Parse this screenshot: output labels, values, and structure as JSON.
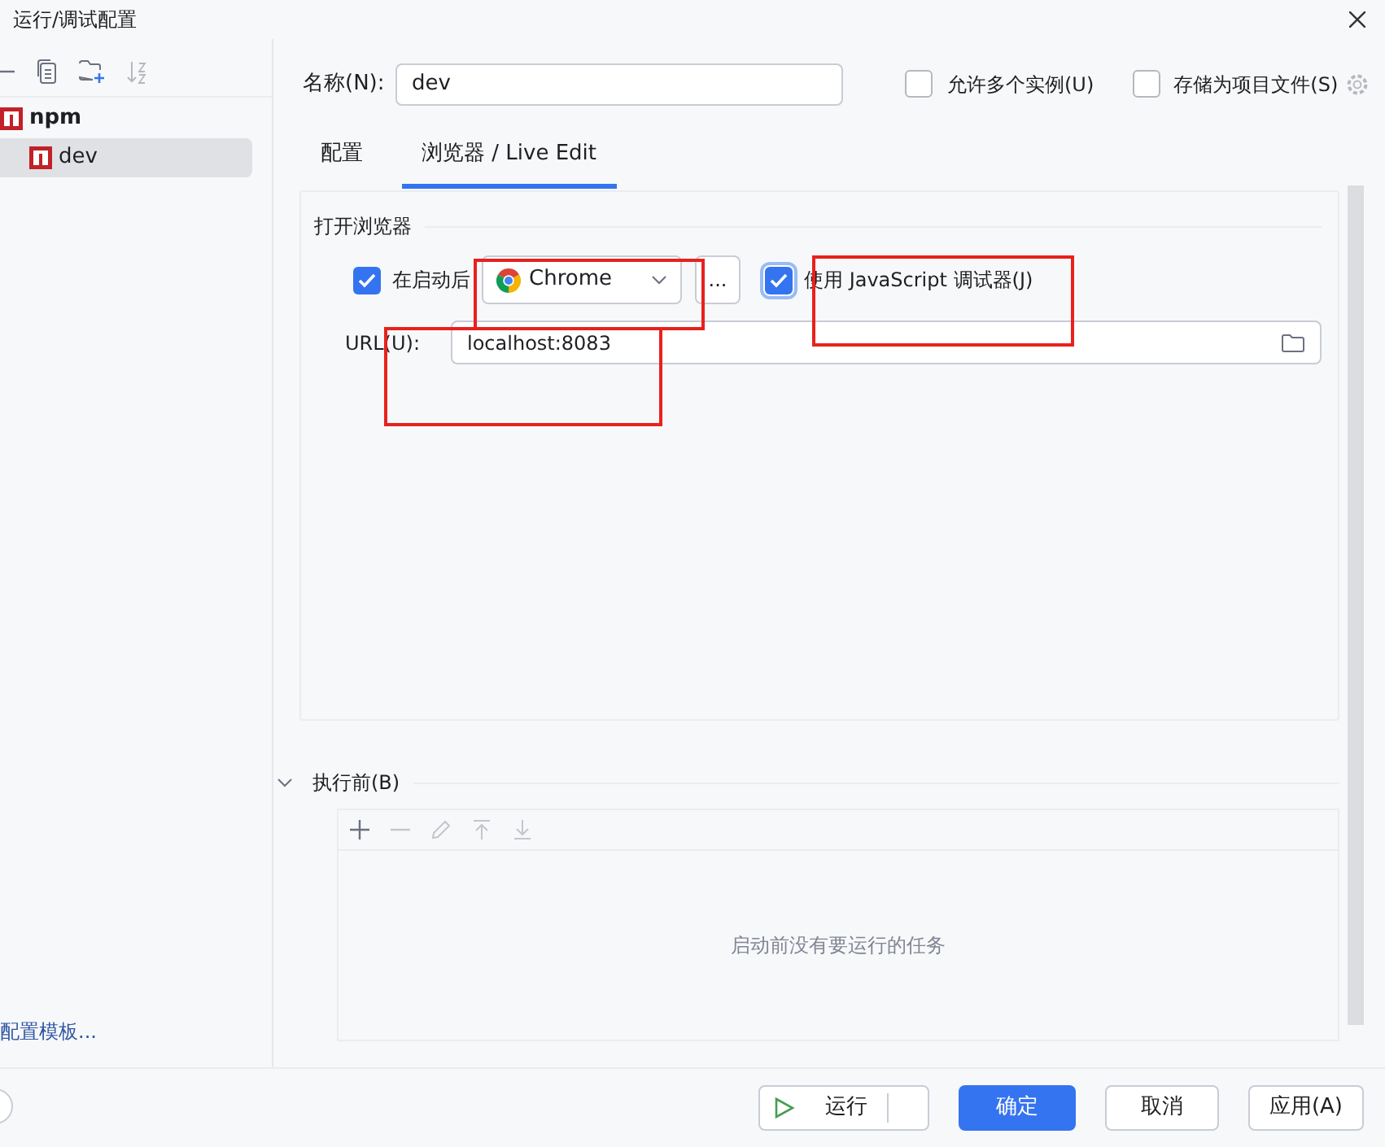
{
  "window": {
    "title": "运行/调试配置"
  },
  "sidebar": {
    "tree": [
      {
        "label": "npm",
        "selected": false,
        "children": [
          {
            "label": "dev",
            "selected": true
          }
        ]
      }
    ],
    "footer_link": "配置模板..."
  },
  "name_field": {
    "label": "名称(N):",
    "value": "dev"
  },
  "options": [
    {
      "label": "允许多个实例(U)",
      "checked": false
    },
    {
      "label": "存储为项目文件(S)",
      "checked": false
    }
  ],
  "tabs": [
    {
      "label": "配置",
      "selected": false
    },
    {
      "label": "浏览器 / Live Edit",
      "selected": true
    }
  ],
  "browser_section": {
    "title": "打开浏览器",
    "launch": {
      "label": "在启动后",
      "checked": true
    },
    "browser": "Chrome",
    "more_button": "...",
    "js_debugger": {
      "label": "使用 JavaScript 调试器(J)",
      "checked": true
    },
    "url": {
      "label": "URL(U):",
      "value": "localhost:8083"
    }
  },
  "before_launch": {
    "title": "执行前(B)",
    "expanded": true,
    "empty_text": "启动前没有要运行的任务"
  },
  "buttons": [
    {
      "label": "运行",
      "kind": "run"
    },
    {
      "label": "确定",
      "kind": "primary"
    },
    {
      "label": "取消",
      "kind": "plain"
    },
    {
      "label": "应用(A)",
      "kind": "plain"
    }
  ]
}
